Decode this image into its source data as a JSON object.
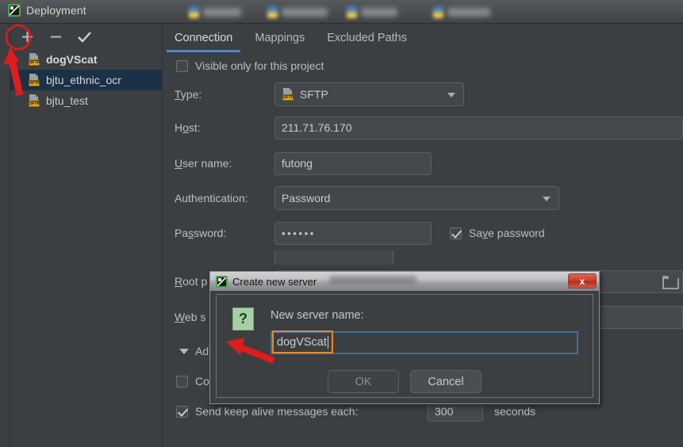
{
  "window": {
    "title": "Deployment",
    "icon": "pycharm-icon"
  },
  "toolbar": {
    "add_label": "+",
    "remove_label": "−",
    "check_label": "✓",
    "add_icon": "plus-icon",
    "remove_icon": "minus-icon",
    "default_icon": "check-icon"
  },
  "server_list": {
    "items": [
      {
        "name": "dogVScat",
        "type": "SFTP",
        "state": "new"
      },
      {
        "name": "bjtu_ethnic_ocr",
        "type": "SFTP",
        "state": "selected"
      },
      {
        "name": "bjtu_test",
        "type": "SFTP",
        "state": "normal"
      }
    ]
  },
  "tabs": [
    {
      "label": "Connection",
      "active": true
    },
    {
      "label": "Mappings",
      "active": false
    },
    {
      "label": "Excluded Paths",
      "active": false
    }
  ],
  "form": {
    "visible_only_label": "Visible only for this project",
    "visible_only_checked": false,
    "type_label": "Type:",
    "type_value": "SFTP",
    "host_label": "Host:",
    "host_value": "211.71.76.170",
    "username_label": "User name:",
    "username_value": "futong",
    "auth_label": "Authentication:",
    "auth_value": "Password",
    "password_label": "Password:",
    "password_value": "••••••",
    "save_password_label": "Save password",
    "save_password_checked": true,
    "root_path_label": "Root p",
    "web_server_label": "Web s",
    "advanced_label": "Ad",
    "concurrent_label": "Concurrent connections limit:",
    "concurrent_checked": false,
    "concurrent_value": "",
    "keepalive_label": "Send keep alive messages each:",
    "keepalive_checked": true,
    "keepalive_value": "300",
    "keepalive_unit": "seconds",
    "folder_icon": "folder-browse-icon"
  },
  "dialog": {
    "title": "Create new server",
    "icon": "pycharm-icon",
    "close_label": "x",
    "question_icon": "?",
    "field_label": "New server name:",
    "field_value": "dogVScat",
    "ok_label": "OK",
    "cancel_label": "Cancel"
  },
  "colors": {
    "background": "#3c3f41",
    "selection": "#1b3147",
    "tab_accent": "#4a88c7",
    "annotation": "#e01b1b",
    "highlight": "#e8882a",
    "focus_border": "#3f6d9e",
    "sftp_badge": "#e0a52a"
  }
}
